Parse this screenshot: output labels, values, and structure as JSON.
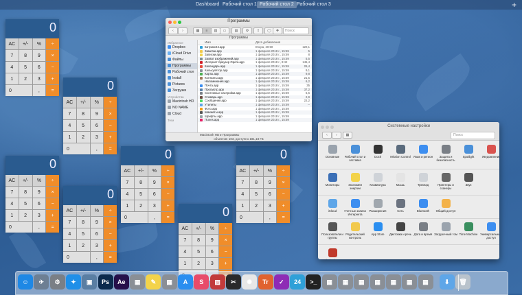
{
  "spaces": {
    "items": [
      {
        "label": "Dashboard",
        "active": false
      },
      {
        "label": "Рабочий стол 1",
        "active": false
      },
      {
        "label": "Рабочий стол 2",
        "active": true
      },
      {
        "label": "Рабочий стол 3",
        "active": false
      }
    ],
    "add_label": "+"
  },
  "calculator": {
    "display": "0",
    "keys": [
      "AC",
      "+/-",
      "%",
      "÷",
      "7",
      "8",
      "9",
      "×",
      "4",
      "5",
      "6",
      "−",
      "1",
      "2",
      "3",
      "+",
      "0",
      ",",
      "="
    ]
  },
  "finder": {
    "title": "Программы",
    "path": "Программы",
    "search_placeholder": "Поиск",
    "sidebar": {
      "favorites_header": "Избранное",
      "favorites": [
        "Dropbox",
        "iCloud Drive",
        "Файлы",
        "Программы",
        "Рабочий стол",
        "Install",
        "Pictures",
        "Загрузки"
      ],
      "devices_header": "Устройства",
      "devices": [
        "Macintosh HD",
        "NO NAME",
        "Cloud"
      ],
      "tags_header": "Теги"
    },
    "columns": {
      "name": "Имя",
      "date": "Дата добавления",
      "size": ""
    },
    "rows": [
      {
        "name": "Битрикс24.app",
        "date": "Вчера, 20:50",
        "size": "120,1"
      },
      {
        "name": "Заметки.app",
        "date": "1 февраля 2018 г., 15:59",
        "size": "5"
      },
      {
        "name": "Записки.app",
        "date": "1 февраля 2018 г., 15:59",
        "size": "8"
      },
      {
        "name": "Захват изображений.app",
        "date": "1 февраля 2018 г., 15:59",
        "size": "5,5"
      },
      {
        "name": "Интернет-браузер Opera.app",
        "date": "1 февраля 2018 г., 8:42",
        "size": "145,4"
      },
      {
        "name": "Календарь.app",
        "date": "1 февраля 2018 г., 15:59",
        "size": "26,4"
      },
      {
        "name": "Калькулятор.app",
        "date": "1 февраля 2018 г., 15:59",
        "size": "9,1"
      },
      {
        "name": "Карты.app",
        "date": "1 февраля 2018 г., 15:59",
        "size": "9,8"
      },
      {
        "name": "Контакты.app",
        "date": "1 февраля 2018 г., 15:59",
        "size": "21,5"
      },
      {
        "name": "Напоминания.app",
        "date": "1 февраля 2018 г., 15:59",
        "size": "6,2"
      },
      {
        "name": "Почта.app",
        "date": "1 февраля 2018 г., 15:59",
        "size": "35"
      },
      {
        "name": "Просмотр.app",
        "date": "1 февраля 2018 г., 15:59",
        "size": "37,2"
      },
      {
        "name": "Системные настройки.app",
        "date": "1 февраля 2018 г., 15:59",
        "size": "5,6"
      },
      {
        "name": "Словарь.app",
        "date": "1 февраля 2018 г., 15:59",
        "size": "2,9"
      },
      {
        "name": "Сообщения.app",
        "date": "1 февраля 2018 г., 15:59",
        "size": "22,2"
      },
      {
        "name": "Утилиты",
        "date": "1 февраля 2018 г., 15:59",
        "size": "--"
      },
      {
        "name": "Фото.app",
        "date": "1 февраля 2018 г., 15:59",
        "size": ""
      },
      {
        "name": "Шахматы.app",
        "date": "1 февраля 2018 г., 15:59",
        "size": ""
      },
      {
        "name": "Шрифты.app",
        "date": "1 февраля 2018 г., 15:59",
        "size": ""
      },
      {
        "name": "iTunes.app",
        "date": "1 февраля 2018 г., 15:59",
        "size": ""
      }
    ],
    "status_path": "Macintosh HD ▸ Программы",
    "status_info": "объектов: 103, доступно 181,18 ГБ"
  },
  "prefs": {
    "title": "Системные настройки",
    "search_placeholder": "Поиск",
    "rows": [
      [
        "Основные",
        "Рабочий стол и заставка",
        "Dock",
        "Mission Control",
        "Язык и регион",
        "Защита и безопасность",
        "Spotlight",
        "Уведомления"
      ],
      [
        "Мониторы",
        "Экономия энергии",
        "Клавиатура",
        "Мышь",
        "Трекпад",
        "Принтеры и сканеры",
        "Звук"
      ],
      [
        "iCloud",
        "Учетные записи Интернета",
        "Расширения",
        "Сеть",
        "Bluetooth",
        "Общий доступ"
      ],
      [
        "Пользователи и группы",
        "Родительский контроль",
        "App Store",
        "Диктовка и речь",
        "Дата и время",
        "Загрузочный том",
        "Time Machine",
        "Универсальный доступ"
      ],
      [
        "Flash Player"
      ]
    ]
  },
  "dock": {
    "items": [
      {
        "name": "finder-icon",
        "glyph": "☺",
        "color": "#1e88e5"
      },
      {
        "name": "launchpad-icon",
        "glyph": "✈",
        "color": "#6d7f93"
      },
      {
        "name": "system-preferences-icon",
        "glyph": "⚙",
        "color": "#7a7f86"
      },
      {
        "name": "safari-icon",
        "glyph": "✦",
        "color": "#1f8fe8"
      },
      {
        "name": "preview-icon",
        "glyph": "▣",
        "color": "#5a7ea3"
      },
      {
        "name": "photoshop-icon",
        "glyph": "Ps",
        "color": "#0c2a4d"
      },
      {
        "name": "after-effects-icon",
        "glyph": "Ae",
        "color": "#26104a"
      },
      {
        "name": "calculator-icon",
        "glyph": "▦",
        "color": "#8a8f96"
      },
      {
        "name": "notes-icon",
        "glyph": "✎",
        "color": "#f3d34a"
      },
      {
        "name": "calculator-icon",
        "glyph": "▦",
        "color": "#8a8f96"
      },
      {
        "name": "app-store-icon",
        "glyph": "A",
        "color": "#2a8ef0"
      },
      {
        "name": "skitch-icon",
        "glyph": "S",
        "color": "#e84b6a"
      },
      {
        "name": "photo-booth-icon",
        "glyph": "▨",
        "color": "#c23b3b"
      },
      {
        "name": "final-cut-icon",
        "glyph": "✂",
        "color": "#2a2a2a"
      },
      {
        "name": "flash-icon",
        "glyph": "✺",
        "color": "#e7e7e7"
      },
      {
        "name": "transmit-icon",
        "glyph": "Tr",
        "color": "#e0622f"
      },
      {
        "name": "opera-icon",
        "glyph": "✓",
        "color": "#8e2bb5"
      },
      {
        "name": "bitrix24-icon",
        "glyph": "24",
        "color": "#2fa0d8"
      },
      {
        "name": "terminal-icon",
        "glyph": ">_",
        "color": "#222222"
      },
      {
        "name": "calculator-icon",
        "glyph": "▦",
        "color": "#8a8f96"
      },
      {
        "name": "calculator-icon",
        "glyph": "▦",
        "color": "#8a8f96"
      },
      {
        "name": "calculator-icon",
        "glyph": "▦",
        "color": "#8a8f96"
      },
      {
        "name": "calculator-icon",
        "glyph": "▦",
        "color": "#8a8f96"
      },
      {
        "name": "calculator-icon",
        "glyph": "▦",
        "color": "#8a8f96"
      },
      {
        "name": "calculator-icon",
        "glyph": "▦",
        "color": "#8a8f96"
      },
      {
        "name": "calculator-icon",
        "glyph": "▦",
        "color": "#8a8f96"
      },
      {
        "name": "downloads-folder-icon",
        "glyph": "⬇",
        "color": "#5ea6e8"
      },
      {
        "name": "trash-icon",
        "glyph": "🗑",
        "color": "#b9c3cc"
      }
    ]
  }
}
